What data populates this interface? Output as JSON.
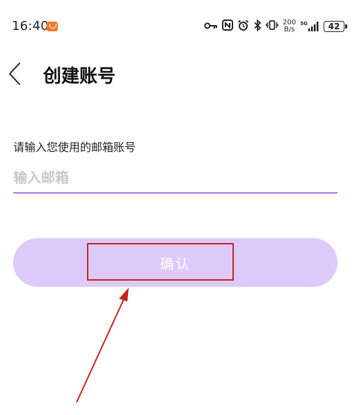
{
  "status_bar": {
    "time": "16:40",
    "net_speed_value": "200",
    "net_speed_unit": "B/s",
    "signal_label": "5G",
    "battery": "42"
  },
  "header": {
    "title": "创建账号"
  },
  "form": {
    "label": "请输入您使用的邮箱账号",
    "email_placeholder": "输入邮箱",
    "email_value": ""
  },
  "confirm_button": {
    "label": "确认"
  },
  "colors": {
    "accent": "#a377e6",
    "button_bg": "#dccbfa",
    "annotation": "#c4221f"
  },
  "icons": [
    "key-icon",
    "nfc-icon",
    "alarm-icon",
    "bluetooth-icon",
    "vibrate-icon",
    "signal-icon",
    "battery-icon",
    "back-arrow-icon"
  ]
}
